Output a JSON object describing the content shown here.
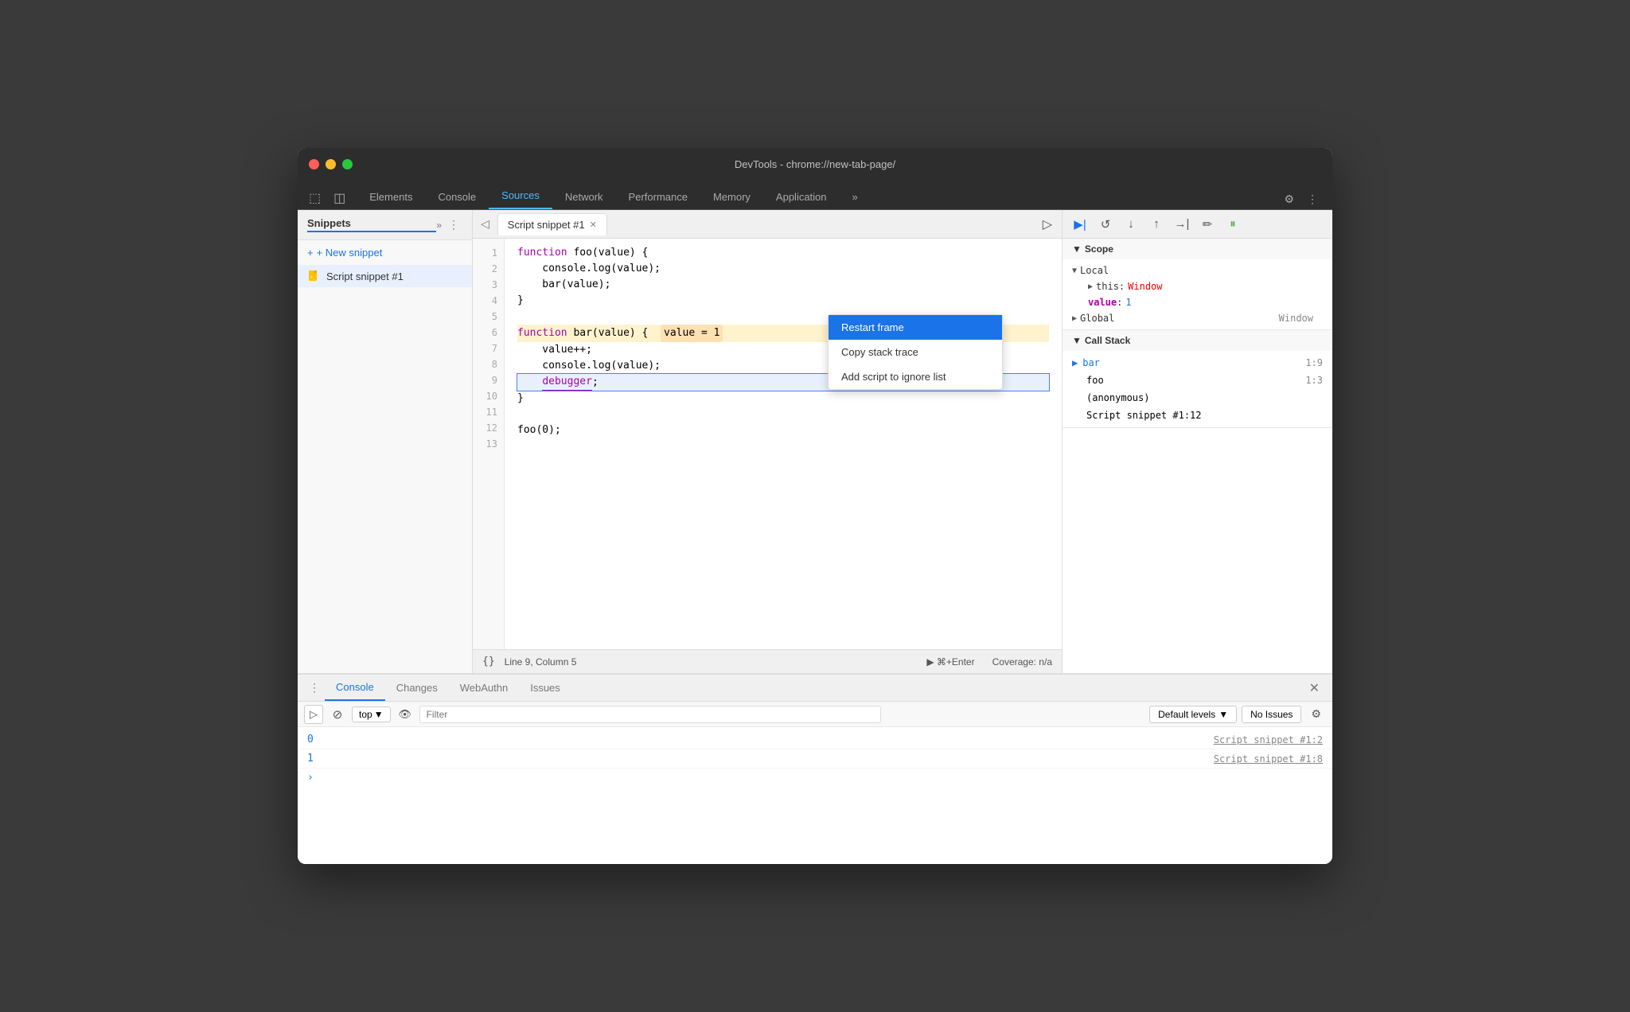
{
  "window": {
    "title": "DevTools - chrome://new-tab-page/"
  },
  "traffic_lights": {
    "close": "close",
    "minimize": "minimize",
    "maximize": "maximize"
  },
  "main_tabs": [
    {
      "label": "Elements",
      "active": false
    },
    {
      "label": "Console",
      "active": false
    },
    {
      "label": "Sources",
      "active": true
    },
    {
      "label": "Network",
      "active": false
    },
    {
      "label": "Performance",
      "active": false
    },
    {
      "label": "Memory",
      "active": false
    },
    {
      "label": "Application",
      "active": false
    }
  ],
  "sidebar": {
    "title": "Snippets",
    "new_snippet_label": "+ New snippet",
    "snippet_item_label": "Script snippet #1"
  },
  "editor": {
    "tab_label": "Script snippet #1",
    "code_lines": [
      {
        "num": 1,
        "text": "function foo(value) {",
        "type": "normal"
      },
      {
        "num": 2,
        "text": "    console.log(value);",
        "type": "normal"
      },
      {
        "num": 3,
        "text": "    bar(value);",
        "type": "normal"
      },
      {
        "num": 4,
        "text": "}",
        "type": "normal"
      },
      {
        "num": 5,
        "text": "",
        "type": "normal"
      },
      {
        "num": 6,
        "text": "function bar(value) {",
        "type": "highlighted",
        "highlight": "value = 1"
      },
      {
        "num": 7,
        "text": "    value++;",
        "type": "normal"
      },
      {
        "num": 8,
        "text": "    console.log(value);",
        "type": "normal"
      },
      {
        "num": 9,
        "text": "    debugger;",
        "type": "current"
      },
      {
        "num": 10,
        "text": "}",
        "type": "normal"
      },
      {
        "num": 11,
        "text": "",
        "type": "normal"
      },
      {
        "num": 12,
        "text": "foo(0);",
        "type": "normal"
      },
      {
        "num": 13,
        "text": "",
        "type": "normal"
      }
    ]
  },
  "status_bar": {
    "format_btn": "{}",
    "position": "Line 9, Column 5",
    "run_label": "▶ ⌘+Enter",
    "coverage": "Coverage: n/a"
  },
  "debug_toolbar": {
    "buttons": [
      "▶|",
      "↺",
      "↓",
      "↑",
      "→|",
      "✏",
      "⏸"
    ]
  },
  "scope_panel": {
    "title": "Scope",
    "local_label": "Local",
    "this_label": "this:",
    "this_value": "Window",
    "value_label": "value:",
    "value_val": "1",
    "global_label": "Global",
    "global_value": "Window"
  },
  "call_stack": {
    "title": "Call Stack",
    "frames": [
      {
        "name": "bar",
        "location": "1:9",
        "active": true
      },
      {
        "name": "foo",
        "location": "1:3"
      },
      {
        "name": "(anonymous)",
        "location": ""
      },
      {
        "name": "Script snippet #1:12",
        "location": ""
      }
    ]
  },
  "context_menu": {
    "items": [
      {
        "label": "Restart frame",
        "selected": true
      },
      {
        "label": "Copy stack trace",
        "selected": false
      },
      {
        "label": "Add script to ignore list",
        "selected": false
      }
    ]
  },
  "bottom_panel": {
    "tabs": [
      {
        "label": "Console",
        "active": true
      },
      {
        "label": "Changes",
        "active": false
      },
      {
        "label": "WebAuthn",
        "active": false
      },
      {
        "label": "Issues",
        "active": false
      }
    ],
    "filter_placeholder": "Filter",
    "default_levels_label": "Default levels",
    "no_issues_label": "No Issues",
    "top_selector": "top",
    "console_output": [
      {
        "value": "0",
        "source": "Script snippet #1:2"
      },
      {
        "value": "1",
        "source": "Script snippet #1:8"
      }
    ]
  }
}
